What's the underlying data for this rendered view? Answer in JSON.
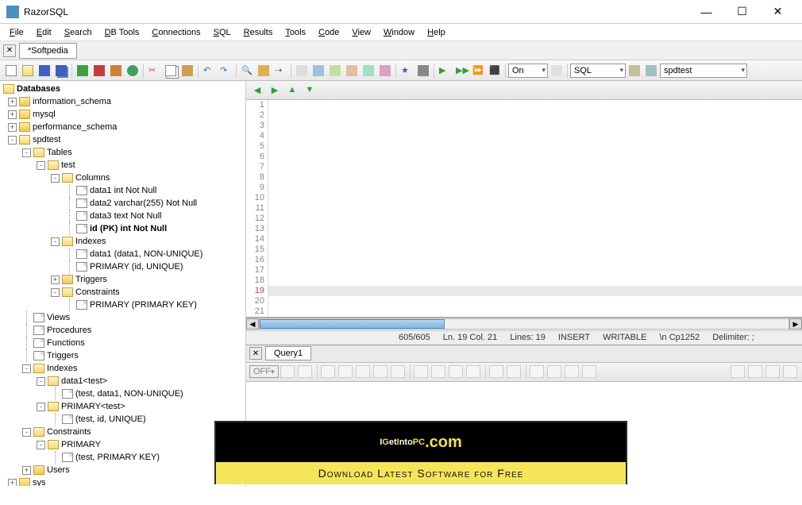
{
  "titlebar": {
    "app": "RazorSQL"
  },
  "menu": [
    "File",
    "Edit",
    "Search",
    "DB Tools",
    "Connections",
    "SQL",
    "Results",
    "Tools",
    "Code",
    "View",
    "Window",
    "Help"
  ],
  "tab": {
    "label": "*Softpedia"
  },
  "toolbar_selects": {
    "on": "On",
    "lang": "SQL",
    "db": "spdtest"
  },
  "tree": {
    "root": "Databases",
    "items": [
      {
        "lvl": 0,
        "exp": "+",
        "icon": "fc",
        "label": "information_schema"
      },
      {
        "lvl": 0,
        "exp": "+",
        "icon": "fc",
        "label": "mysql"
      },
      {
        "lvl": 0,
        "exp": "+",
        "icon": "fc",
        "label": "performance_schema"
      },
      {
        "lvl": 0,
        "exp": "-",
        "icon": "fo",
        "label": "spdtest"
      },
      {
        "lvl": 1,
        "exp": "-",
        "icon": "fo",
        "label": "Tables"
      },
      {
        "lvl": 2,
        "exp": "-",
        "icon": "fo",
        "label": "test"
      },
      {
        "lvl": 3,
        "exp": "-",
        "icon": "fo",
        "label": "Columns"
      },
      {
        "lvl": 4,
        "exp": "",
        "icon": "fi",
        "label": "data1 int Not Null"
      },
      {
        "lvl": 4,
        "exp": "",
        "icon": "fi",
        "label": "data2 varchar(255) Not Null"
      },
      {
        "lvl": 4,
        "exp": "",
        "icon": "fi",
        "label": "data3 text Not Null"
      },
      {
        "lvl": 4,
        "exp": "",
        "icon": "fi",
        "label": "id (PK) int Not Null",
        "bold": true
      },
      {
        "lvl": 3,
        "exp": "-",
        "icon": "fo",
        "label": "Indexes"
      },
      {
        "lvl": 4,
        "exp": "",
        "icon": "fi",
        "label": "data1 (data1, NON-UNIQUE)"
      },
      {
        "lvl": 4,
        "exp": "",
        "icon": "fi",
        "label": "PRIMARY (id, UNIQUE)"
      },
      {
        "lvl": 3,
        "exp": "+",
        "icon": "fc",
        "label": "Triggers"
      },
      {
        "lvl": 3,
        "exp": "-",
        "icon": "fo",
        "label": "Constraints"
      },
      {
        "lvl": 4,
        "exp": "",
        "icon": "fi",
        "label": "PRIMARY (PRIMARY KEY)"
      },
      {
        "lvl": 1,
        "exp": "",
        "icon": "fi",
        "label": "Views"
      },
      {
        "lvl": 1,
        "exp": "",
        "icon": "fi",
        "label": "Procedures"
      },
      {
        "lvl": 1,
        "exp": "",
        "icon": "fi",
        "label": "Functions"
      },
      {
        "lvl": 1,
        "exp": "",
        "icon": "fi",
        "label": "Triggers"
      },
      {
        "lvl": 1,
        "exp": "-",
        "icon": "fo",
        "label": "Indexes"
      },
      {
        "lvl": 2,
        "exp": "-",
        "icon": "fo",
        "label": "data1<test>"
      },
      {
        "lvl": 3,
        "exp": "",
        "icon": "fi",
        "label": "(test, data1, NON-UNIQUE)"
      },
      {
        "lvl": 2,
        "exp": "-",
        "icon": "fo",
        "label": "PRIMARY<test>"
      },
      {
        "lvl": 3,
        "exp": "",
        "icon": "fi",
        "label": "(test, id, UNIQUE)"
      },
      {
        "lvl": 1,
        "exp": "-",
        "icon": "fo",
        "label": "Constraints"
      },
      {
        "lvl": 2,
        "exp": "-",
        "icon": "fo",
        "label": "PRIMARY"
      },
      {
        "lvl": 3,
        "exp": "",
        "icon": "fi",
        "label": "(test, PRIMARY KEY)"
      },
      {
        "lvl": 1,
        "exp": "+",
        "icon": "fc",
        "label": "Users"
      },
      {
        "lvl": 0,
        "exp": "+",
        "icon": "fc",
        "label": "sys"
      }
    ]
  },
  "editor": {
    "line_count": 21,
    "highlighted_line": 19
  },
  "status": {
    "pos": "605/605",
    "lncol": "Ln. 19 Col. 21",
    "lines": "Lines: 19",
    "mode": "INSERT",
    "writable": "WRITABLE",
    "enc": "\\n Cp1252",
    "delim": "Delimiter: ;"
  },
  "results": {
    "tab": "Query1",
    "off": "OFF"
  },
  "banner": {
    "t1": "I",
    "t2": "G",
    "t3": "et",
    "t4": "I",
    "t5": "nto",
    "t6": "PC",
    "t7": ".com",
    "sub": "Download Latest Software for Free"
  }
}
